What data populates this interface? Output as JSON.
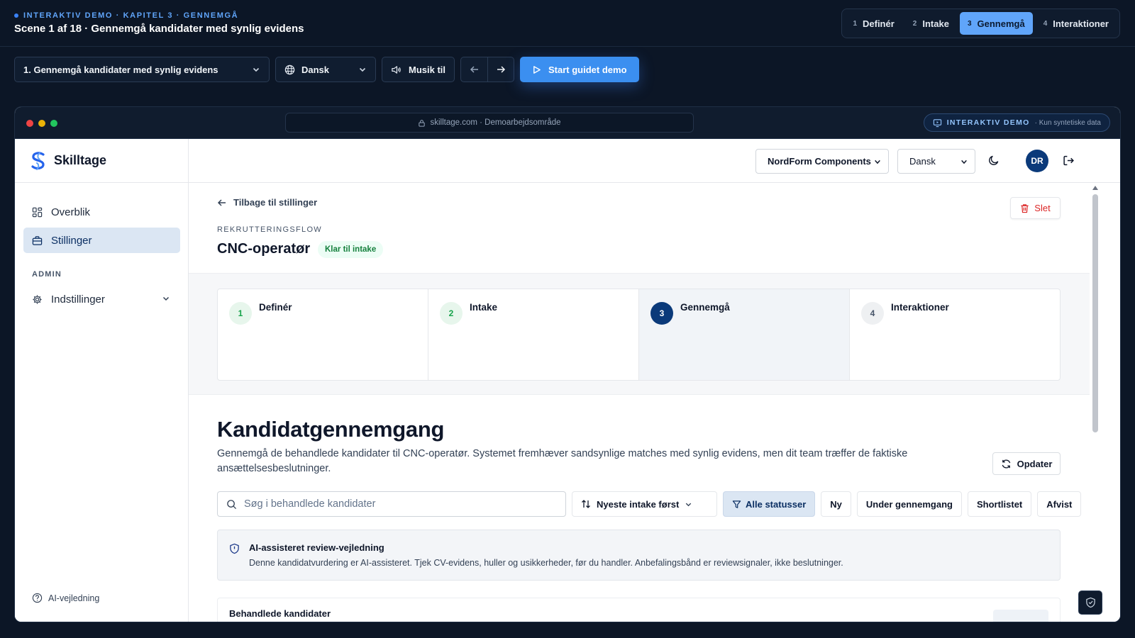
{
  "demo": {
    "eyebrow": "INTERAKTIV DEMO · KAPITEL 3 · GENNEMGÅ",
    "scene_title": "Scene 1 af 18 · Gennemgå kandidater med synlig evidens",
    "chapters": [
      {
        "num": "1",
        "label": "Definér",
        "active": false
      },
      {
        "num": "2",
        "label": "Intake",
        "active": false
      },
      {
        "num": "3",
        "label": "Gennemgå",
        "active": true
      },
      {
        "num": "4",
        "label": "Interaktioner",
        "active": false
      }
    ],
    "scene_select": "1. Gennemgå kandidater med synlig evidens",
    "language": "Dansk",
    "music": "Musik til",
    "start": "Start guidet demo"
  },
  "browser": {
    "url": "skilltage.com · Demoarbejdsområde",
    "badge_title": "INTERAKTIV DEMO",
    "badge_sub": "· Kun syntetiske data"
  },
  "app": {
    "brand": "Skilltage",
    "nav": {
      "overview": "Overblik",
      "positions": "Stillinger",
      "admin": "ADMIN",
      "settings": "Indstillinger",
      "ai_guide": "AI-vejledning"
    },
    "header": {
      "org": "NordForm Components",
      "language": "Dansk",
      "avatar": "DR"
    },
    "page": {
      "back": "Tilbage til stillinger",
      "delete": "Slet",
      "flow_label": "REKRUTTERINGSFLOW",
      "title": "CNC-operatør",
      "badge": "Klar til intake",
      "steps": [
        {
          "num": "1",
          "label": "Definér",
          "state": "done"
        },
        {
          "num": "2",
          "label": "Intake",
          "state": "done"
        },
        {
          "num": "3",
          "label": "Gennemgå",
          "state": "current"
        },
        {
          "num": "4",
          "label": "Interaktioner",
          "state": "todo"
        }
      ],
      "review_title": "Kandidatgennemgang",
      "review_desc": "Gennemgå de behandlede kandidater til CNC-operatør. Systemet fremhæver sandsynlige matches med synlig evidens, men dit team træffer de faktiske ansættelsesbeslutninger.",
      "refresh": "Opdater",
      "search_placeholder": "Søg i behandlede kandidater",
      "sort": "Nyeste intake først",
      "filters": [
        "Alle statusser",
        "Ny",
        "Under gennemgang",
        "Shortlistet",
        "Afvist"
      ],
      "ai_title": "AI-assisteret review-vejledning",
      "ai_desc": "Denne kandidatvurdering er AI-assisteret. Tjek CV-evidens, huller og usikkerheder, før du handler. Anbefalingsbånd er reviewsignaler, ikke beslutninger.",
      "list_title": "Behandlede kandidater"
    }
  },
  "colors": {
    "accent": "#3b8ff0",
    "brand_blue": "#0b3a7a",
    "danger": "#dc2626",
    "success": "#16a34a"
  }
}
